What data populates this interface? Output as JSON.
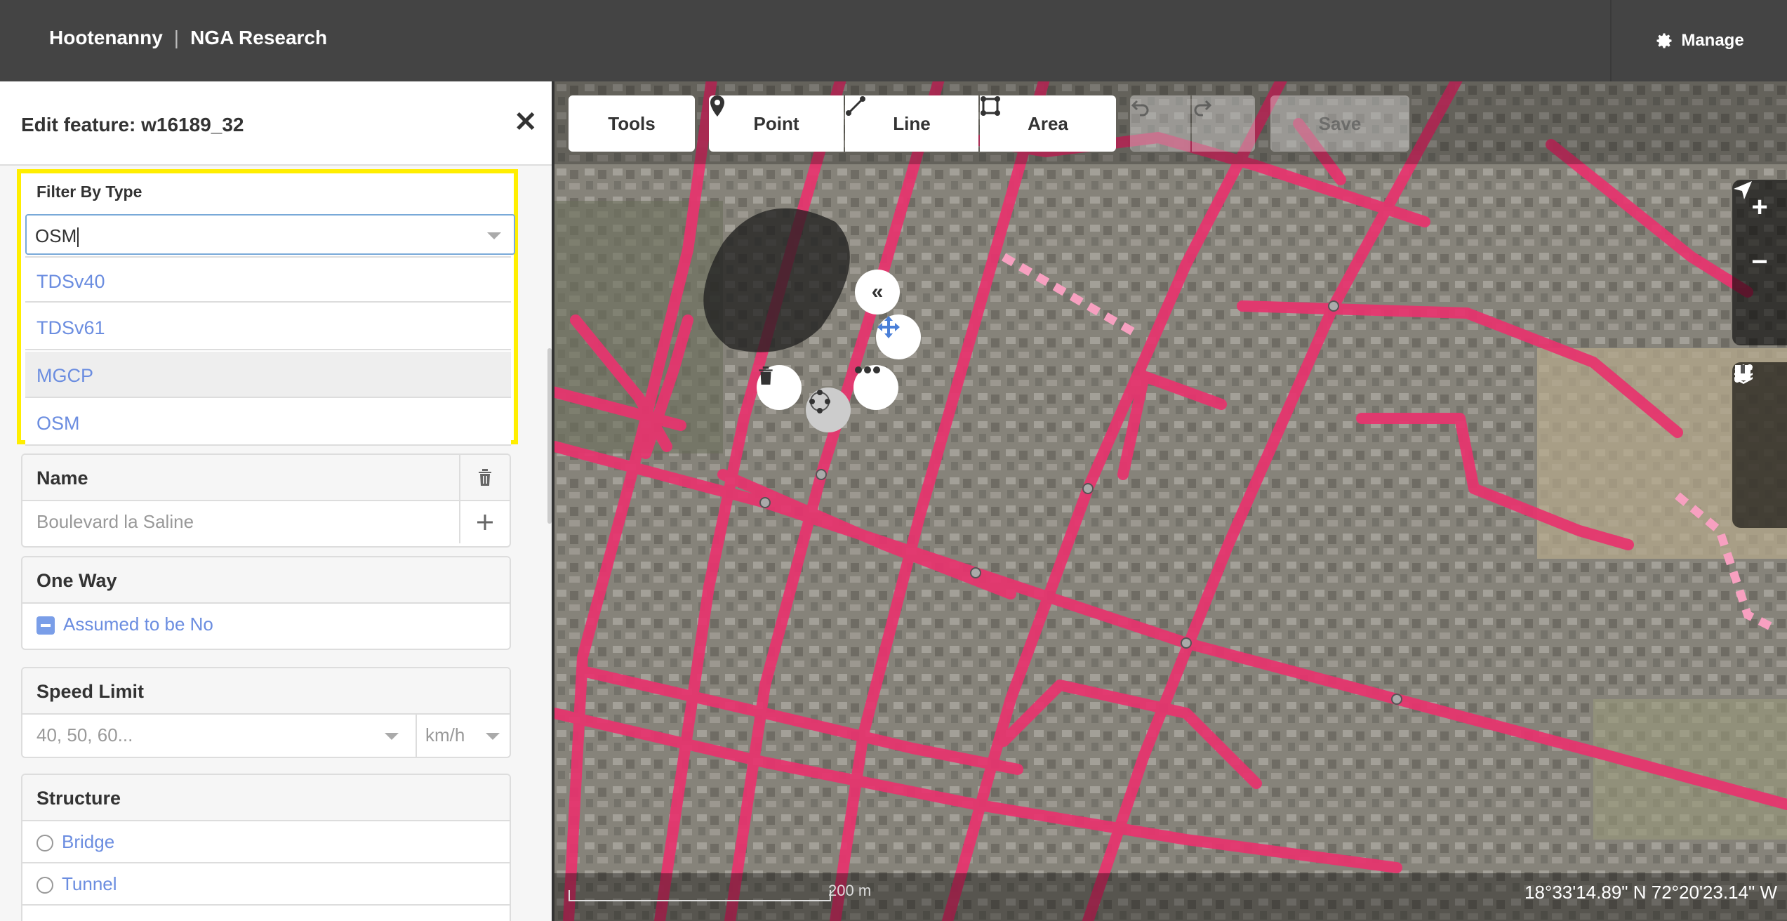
{
  "app": {
    "name": "Hootenanny",
    "project": "NGA Research",
    "manage_label": "Manage"
  },
  "panel": {
    "title": "Edit feature: w16189_32",
    "filter": {
      "label": "Filter By Type",
      "value": "OSM",
      "options": [
        {
          "label": "TDSv40"
        },
        {
          "label": "TDSv61"
        },
        {
          "label": "MGCP",
          "highlighted": true
        },
        {
          "label": "OSM"
        }
      ]
    },
    "fields": {
      "name": {
        "label": "Name",
        "placeholder": "Boulevard la Saline"
      },
      "oneway": {
        "label": "One Way",
        "value": "Assumed to be No"
      },
      "speed": {
        "label": "Speed Limit",
        "placeholder": "40, 50, 60...",
        "unit": "km/h"
      },
      "structure": {
        "label": "Structure",
        "options": [
          "Bridge",
          "Tunnel"
        ]
      }
    }
  },
  "toolbar": {
    "tools": "Tools",
    "point": "Point",
    "line": "Line",
    "area": "Area",
    "save": "Save"
  },
  "map": {
    "scale_label": "200 m",
    "coordinates": "18°33'14.89\" N 72°20'23.14\" W",
    "road_color": "#e8336e"
  },
  "colors": {
    "highlight": "#ffee00",
    "link": "#6b8de0",
    "topbar": "#444444"
  }
}
